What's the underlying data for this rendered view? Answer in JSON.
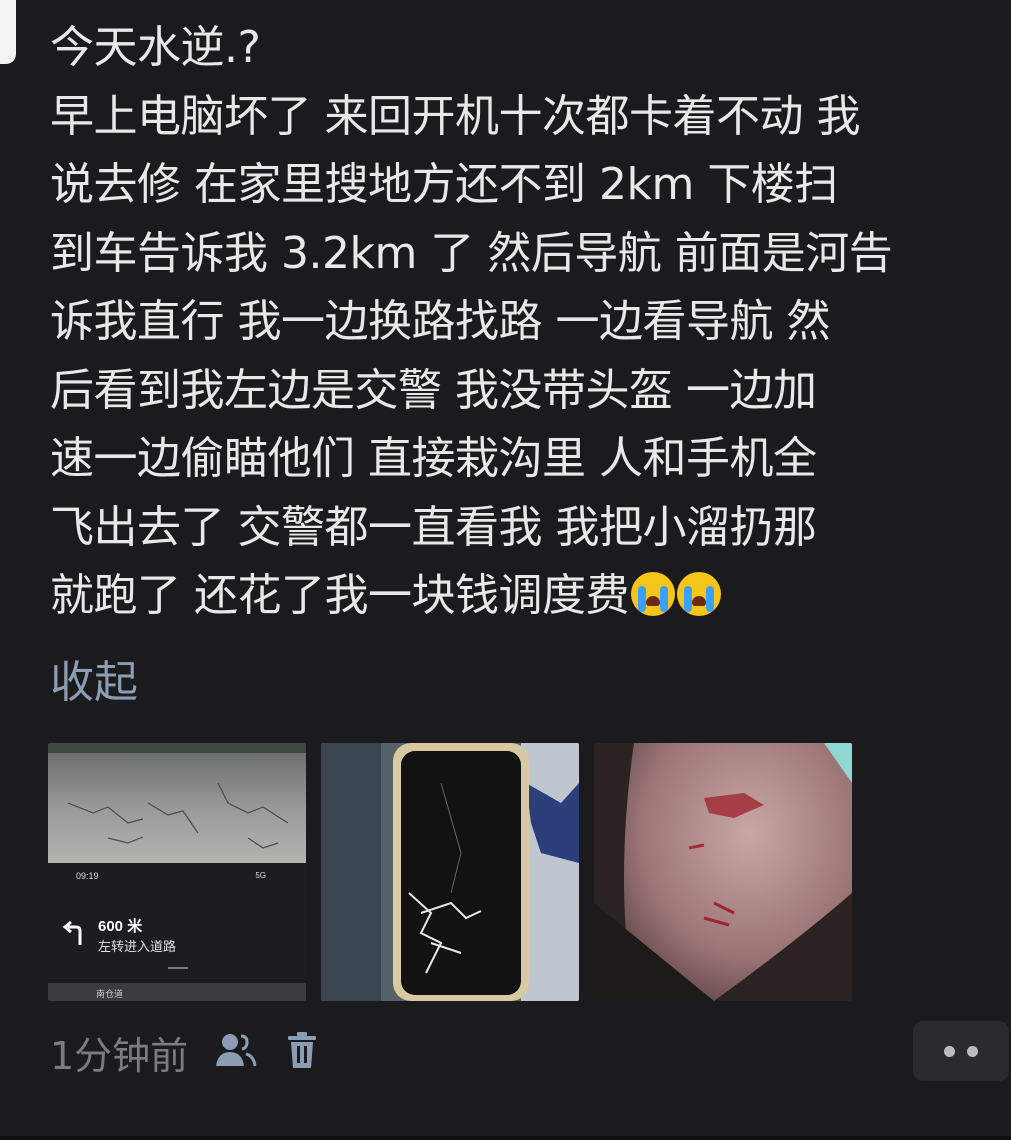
{
  "post": {
    "lines": [
      "今天水逆.?",
      "早上电脑坏了 来回开机十次都卡着不动 我",
      "说去修 在家里搜地方还不到 2km  下楼扫",
      "到车告诉我 3.2km 了 然后导航 前面是河告",
      "诉我直行 我一边换路找路 一边看导航  然",
      "后看到我左边是交警 我没带头盔  一边加",
      "速一边偷瞄他们  直接栽沟里  人和手机全",
      "飞出去了  交警都一直看我 我把小溜扔那",
      "就跑了 还花了我一块钱调度费"
    ],
    "collapse_label": "收起",
    "emojis": [
      "loudly-crying-face",
      "loudly-crying-face"
    ]
  },
  "images": {
    "image_1": {
      "status_time": "09:19",
      "status_signal": "5G",
      "distance": "600 米",
      "instruction": "左转进入道路",
      "next_road": "南仓道"
    },
    "image_2": {
      "subject": "cracked-phone"
    },
    "image_3": {
      "subject": "scraped-skin"
    }
  },
  "footer": {
    "timestamp": "1分钟前",
    "visibility_icon": "friends-icon",
    "delete_icon": "trash-icon",
    "more_icon": "more-dots-icon"
  },
  "colors": {
    "background": "#1b1b1d",
    "text": "#e8e8e8",
    "link": "#8a9db3",
    "meta": "#7c7c80"
  }
}
